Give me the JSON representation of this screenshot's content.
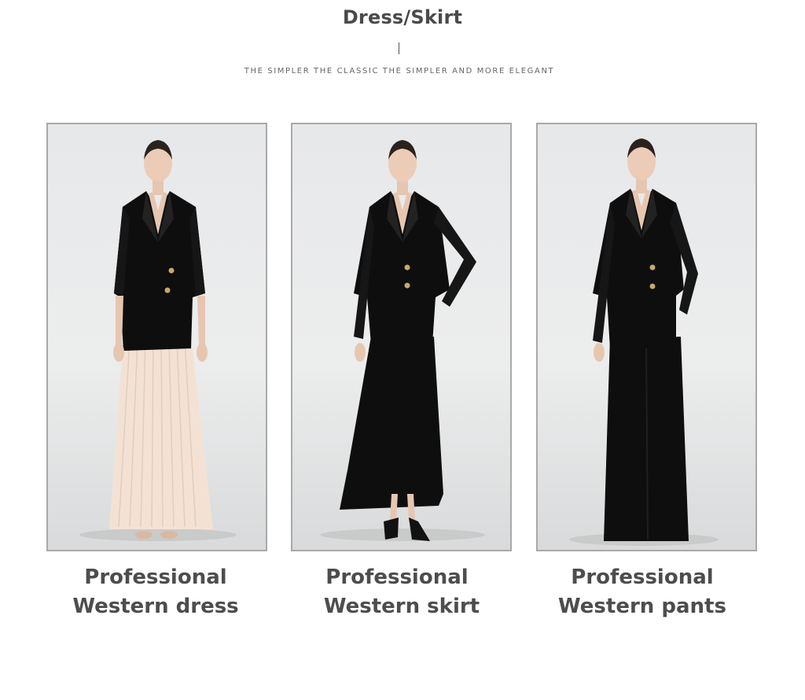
{
  "header": {
    "title": "Dress/Skirt",
    "tagline": "THE SIMPLER THE CLASSIC THE SIMPLER AND MORE ELEGANT"
  },
  "products": [
    {
      "line1": "Professional",
      "line2": "Western dress",
      "image_icon": "model-blazer-pleated-maxi-skirt-photo"
    },
    {
      "line1": "Professional",
      "line2": "Western skirt",
      "image_icon": "model-blazer-black-maxi-skirt-photo"
    },
    {
      "line1": "Professional",
      "line2": "Western pants",
      "image_icon": "model-blazer-wide-leg-pants-photo"
    }
  ],
  "colors": {
    "text": "#4a4a4a",
    "border": "#a9a9a9",
    "garment": "#0e0e0e",
    "pleated_skirt": "#f3e2d4"
  }
}
